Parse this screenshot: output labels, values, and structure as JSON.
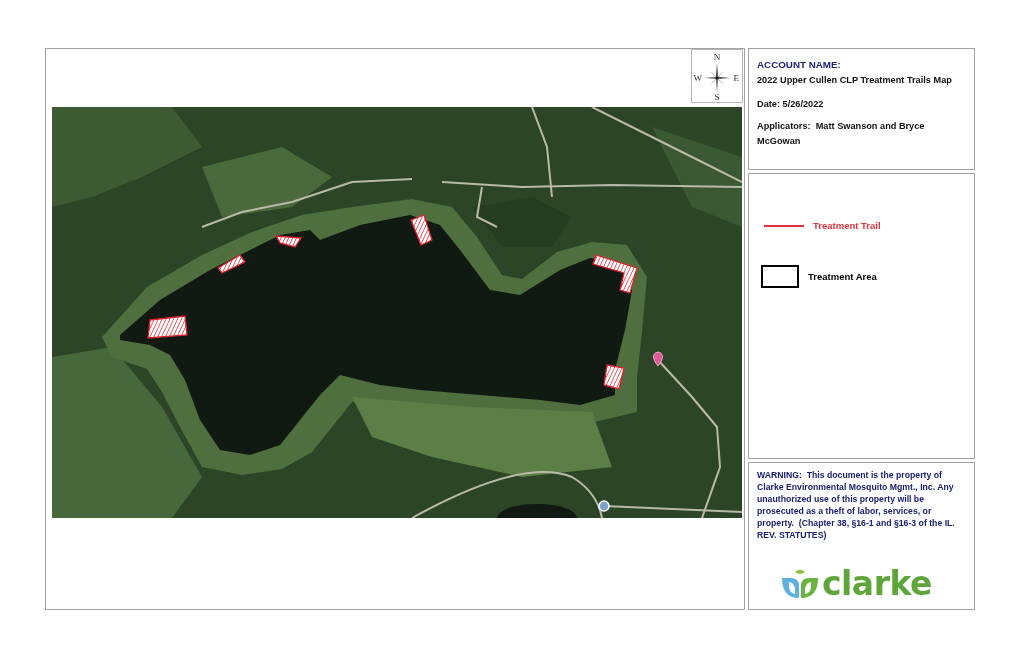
{
  "compass": {
    "north": "N",
    "west": "W",
    "east": "E",
    "south": "S"
  },
  "info": {
    "heading": "ACCOUNT NAME:",
    "title": "2022 Upper Cullen CLP Treatment Trails Map",
    "date": "Date: 5/26/2022",
    "applicators": "Applicators:  Matt Swanson and Bryce McGowan"
  },
  "legend": [
    {
      "kind": "line",
      "label": "Treatment Trail",
      "color": "#e0323c"
    },
    {
      "kind": "box",
      "label": "Treatment Area",
      "color": "#000000"
    }
  ],
  "warning": "WARNING:  This document is the property of Clarke Environmental Mosquito Mgmt., Inc. Any unauthorized use of this property will be prosecuted as a theft of labor, services, or property.  (Chapter 38, §16-1 and §16-3 of the IL. REV. STATUTES)",
  "logo": {
    "wordmark": "clarke"
  }
}
